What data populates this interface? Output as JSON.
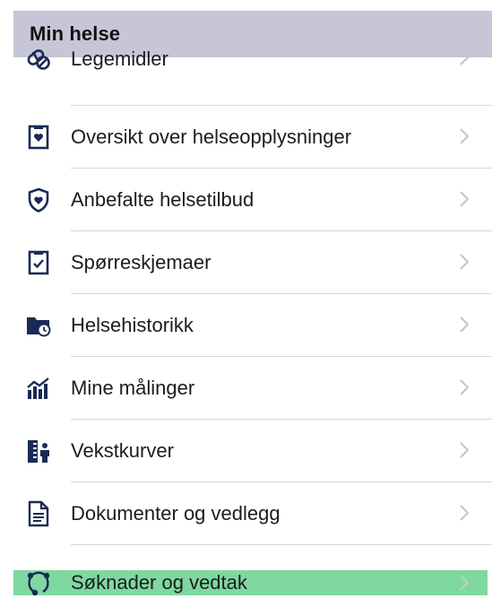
{
  "section": {
    "title": "Min helse"
  },
  "items": [
    {
      "label": "Legemidler",
      "icon": "pill-icon"
    },
    {
      "label": "Oversikt over helseopplysninger",
      "icon": "clipboard-heart-icon"
    },
    {
      "label": "Anbefalte helsetilbud",
      "icon": "shield-heart-icon"
    },
    {
      "label": "Spørreskjemaer",
      "icon": "clipboard-check-icon"
    },
    {
      "label": "Helsehistorikk",
      "icon": "folder-clock-icon"
    },
    {
      "label": "Mine målinger",
      "icon": "chart-bars-icon"
    },
    {
      "label": "Vekstkurver",
      "icon": "growth-chart-icon"
    },
    {
      "label": "Dokumenter og vedlegg",
      "icon": "document-icon"
    },
    {
      "label": "Søknader og vedtak",
      "icon": "connected-nodes-icon"
    }
  ],
  "colors": {
    "header_bg": "#c6c6d6",
    "icon": "#1b2a55",
    "highlight": "#7fd8a0",
    "chevron": "#c4c4c8"
  }
}
